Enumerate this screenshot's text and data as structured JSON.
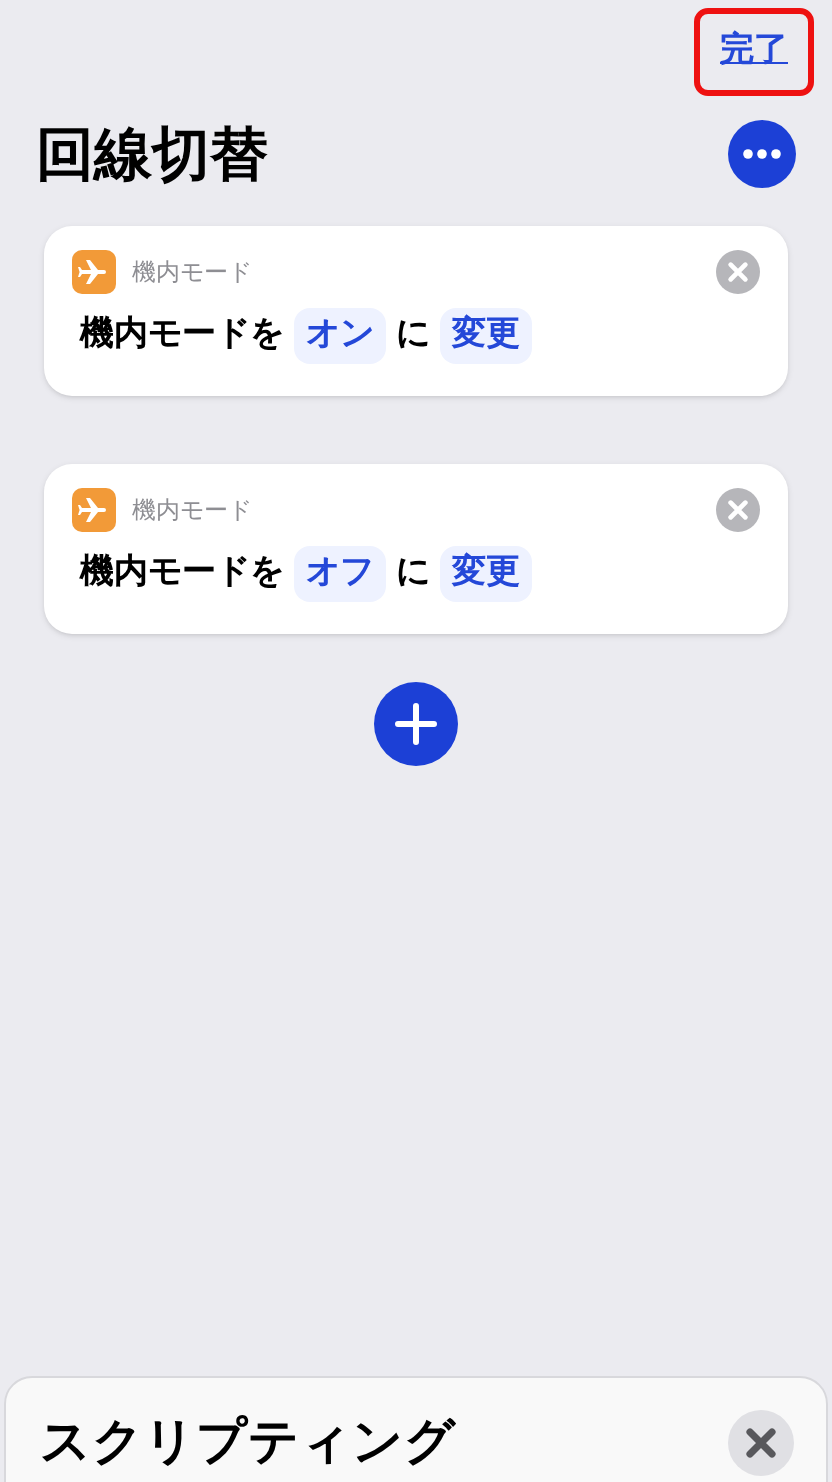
{
  "header": {
    "done": "完了",
    "done_highlighted": true,
    "title": "回線切替"
  },
  "actions": [
    {
      "app": "機内モード",
      "prefix": "機内モードを",
      "value": "オン",
      "joiner": "に",
      "verb": "変更"
    },
    {
      "app": "機内モード",
      "prefix": "機内モードを",
      "value": "オフ",
      "joiner": "に",
      "verb": "変更"
    }
  ],
  "bottom_sheet": {
    "title": "スクリプティング"
  }
}
